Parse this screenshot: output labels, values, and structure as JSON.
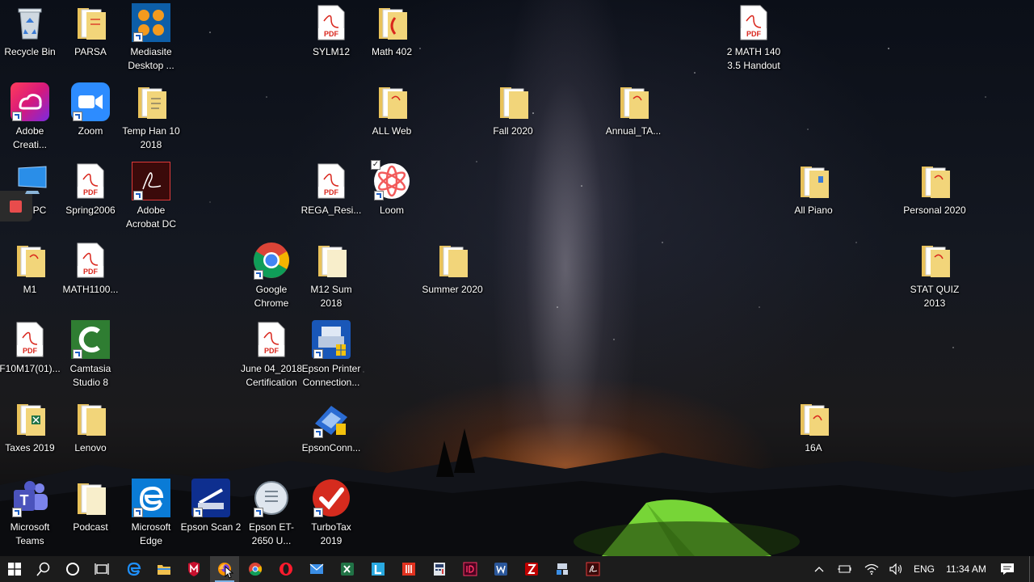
{
  "desktop": {
    "icons": [
      {
        "label": "Recycle Bin",
        "icon": "recycle-bin-icon"
      },
      {
        "label": "PARSA",
        "icon": "folder-icon"
      },
      {
        "label": "Mediasite Desktop ...",
        "icon": "mediasite-icon"
      },
      {
        "label": "SYLM12",
        "icon": "pdf-icon"
      },
      {
        "label": "Math 402",
        "icon": "folder-icon"
      },
      {
        "label": "2 MATH 140 3.5 Handout",
        "icon": "pdf-icon"
      },
      {
        "label": "Adobe Creati...",
        "icon": "adobe-creative-cloud-icon"
      },
      {
        "label": "Zoom",
        "icon": "zoom-icon"
      },
      {
        "label": "Temp Han 10 2018",
        "icon": "folder-icon"
      },
      {
        "label": "ALL Web",
        "icon": "folder-icon"
      },
      {
        "label": "Fall 2020",
        "icon": "folder-icon"
      },
      {
        "label": "Annual_TA...",
        "icon": "folder-icon"
      },
      {
        "label": "PC",
        "icon": "this-pc-icon"
      },
      {
        "label": "Spring2006",
        "icon": "pdf-icon"
      },
      {
        "label": "Adobe Acrobat DC",
        "icon": "acrobat-icon"
      },
      {
        "label": "REGA_Resi...",
        "icon": "pdf-icon"
      },
      {
        "label": "Loom",
        "icon": "loom-icon"
      },
      {
        "label": "All Piano",
        "icon": "folder-icon"
      },
      {
        "label": "Personal 2020",
        "icon": "folder-icon"
      },
      {
        "label": "M1",
        "icon": "folder-icon"
      },
      {
        "label": "MATH1100...",
        "icon": "pdf-icon"
      },
      {
        "label": "Google Chrome",
        "icon": "chrome-icon"
      },
      {
        "label": "M12 Sum 2018",
        "icon": "folder-icon"
      },
      {
        "label": "Summer 2020",
        "icon": "folder-icon"
      },
      {
        "label": "STAT QUIZ 2013",
        "icon": "folder-icon"
      },
      {
        "label": "F10M17(01)...",
        "icon": "pdf-icon"
      },
      {
        "label": "Camtasia Studio 8",
        "icon": "camtasia-icon"
      },
      {
        "label": "June 04_2018 Certification",
        "icon": "pdf-icon"
      },
      {
        "label": "Epson Printer Connection...",
        "icon": "epson-printer-icon"
      },
      {
        "label": "Taxes 2019",
        "icon": "folder-icon"
      },
      {
        "label": "Lenovo",
        "icon": "folder-icon"
      },
      {
        "label": "EpsonConn...",
        "icon": "epson-connect-icon"
      },
      {
        "label": "16A",
        "icon": "folder-icon"
      },
      {
        "label": "Microsoft Teams",
        "icon": "teams-icon"
      },
      {
        "label": "Podcast",
        "icon": "folder-icon"
      },
      {
        "label": "Microsoft Edge",
        "icon": "edge-icon"
      },
      {
        "label": "Epson Scan 2",
        "icon": "epson-scan-icon"
      },
      {
        "label": "Epson ET-2650 U...",
        "icon": "epson-manual-icon"
      },
      {
        "label": "TurboTax 2019",
        "icon": "turbotax-icon"
      }
    ]
  },
  "pdf_badge": "PDF",
  "teams_letter": "T",
  "taskbar": {
    "language": "ENG",
    "time": "11:34 AM",
    "apps": [
      "start-icon",
      "search-icon",
      "cortana-icon",
      "task-view-icon",
      "edge-icon",
      "file-explorer-icon",
      "mcafee-icon",
      "firefox-icon",
      "chrome-icon",
      "opera-icon",
      "mail-icon",
      "excel-icon",
      "loom-l-icon",
      "red-app-icon",
      "calculator-icon",
      "indesign-icon",
      "word-icon",
      "filezilla-icon",
      "network-tool-icon",
      "acrobat-icon"
    ]
  },
  "colors": {
    "folder": "#f2d57a",
    "pdf_red": "#d9261c",
    "taskbar_bg": "#1c1c1c",
    "accent_blue": "#1e5fc4",
    "tent_green": "#7de03a"
  }
}
